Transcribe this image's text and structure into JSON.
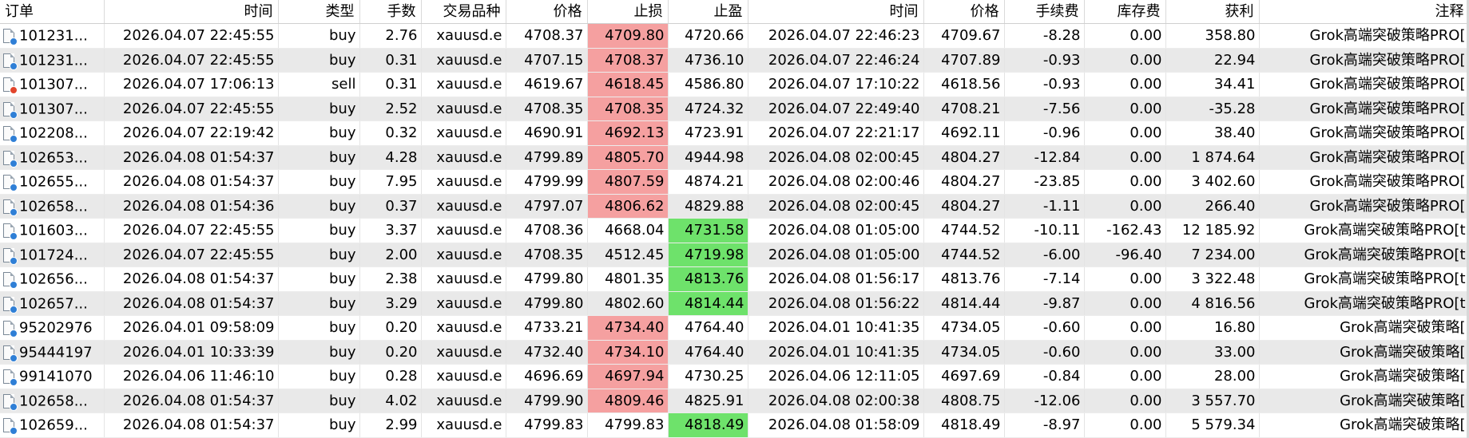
{
  "columns": [
    {
      "key": "order",
      "label": "订单"
    },
    {
      "key": "open_time",
      "label": "时间"
    },
    {
      "key": "type",
      "label": "类型"
    },
    {
      "key": "volume",
      "label": "手数"
    },
    {
      "key": "symbol",
      "label": "交易品种"
    },
    {
      "key": "open_price",
      "label": "价格"
    },
    {
      "key": "sl",
      "label": "止损"
    },
    {
      "key": "tp",
      "label": "止盈"
    },
    {
      "key": "close_time",
      "label": "时间"
    },
    {
      "key": "close_price",
      "label": "价格"
    },
    {
      "key": "commission",
      "label": "手续费"
    },
    {
      "key": "swap",
      "label": "库存费"
    },
    {
      "key": "profit",
      "label": "获利"
    },
    {
      "key": "comment",
      "label": "注释"
    }
  ],
  "colors": {
    "sl_highlight": "#f5a0a0",
    "tp_highlight": "#6ee26b",
    "alt_row": "#e9e9e9",
    "buy_dot": "#2f7fd6",
    "sell_dot": "#e2452c"
  },
  "rows": [
    {
      "icon": "buy-position-icon",
      "order": "101231...",
      "open_time": "2026.04.07 22:45:55",
      "type": "buy",
      "volume": "2.76",
      "symbol": "xauusd.e",
      "open_price": "4708.37",
      "sl": "4709.80",
      "tp": "4720.66",
      "close_time": "2026.04.07 22:46:23",
      "close_price": "4709.67",
      "commission": "-8.28",
      "swap": "0.00",
      "profit": "358.80",
      "comment": "Grok高端突破策略PRO[",
      "hit": "sl"
    },
    {
      "icon": "buy-position-icon",
      "order": "101231...",
      "open_time": "2026.04.07 22:45:55",
      "type": "buy",
      "volume": "0.31",
      "symbol": "xauusd.e",
      "open_price": "4707.15",
      "sl": "4708.37",
      "tp": "4736.10",
      "close_time": "2026.04.07 22:46:24",
      "close_price": "4707.89",
      "commission": "-0.93",
      "swap": "0.00",
      "profit": "22.94",
      "comment": "Grok高端突破策略PRO[",
      "hit": "sl"
    },
    {
      "icon": "sell-position-icon",
      "order": "101307...",
      "open_time": "2026.04.07 17:06:13",
      "type": "sell",
      "volume": "0.31",
      "symbol": "xauusd.e",
      "open_price": "4619.67",
      "sl": "4618.45",
      "tp": "4586.80",
      "close_time": "2026.04.07 17:10:22",
      "close_price": "4618.56",
      "commission": "-0.93",
      "swap": "0.00",
      "profit": "34.41",
      "comment": "Grok高端突破策略PRO[",
      "hit": "sl"
    },
    {
      "icon": "buy-position-icon",
      "order": "101307...",
      "open_time": "2026.04.07 22:45:55",
      "type": "buy",
      "volume": "2.52",
      "symbol": "xauusd.e",
      "open_price": "4708.35",
      "sl": "4708.35",
      "tp": "4724.32",
      "close_time": "2026.04.07 22:49:40",
      "close_price": "4708.21",
      "commission": "-7.56",
      "swap": "0.00",
      "profit": "-35.28",
      "comment": "Grok高端突破策略PRO[",
      "hit": "sl"
    },
    {
      "icon": "buy-position-icon",
      "order": "102208...",
      "open_time": "2026.04.07 22:19:42",
      "type": "buy",
      "volume": "0.32",
      "symbol": "xauusd.e",
      "open_price": "4690.91",
      "sl": "4692.13",
      "tp": "4723.91",
      "close_time": "2026.04.07 22:21:17",
      "close_price": "4692.11",
      "commission": "-0.96",
      "swap": "0.00",
      "profit": "38.40",
      "comment": "Grok高端突破策略PRO[",
      "hit": "sl"
    },
    {
      "icon": "buy-position-icon",
      "order": "102653...",
      "open_time": "2026.04.08 01:54:37",
      "type": "buy",
      "volume": "4.28",
      "symbol": "xauusd.e",
      "open_price": "4799.89",
      "sl": "4805.70",
      "tp": "4944.98",
      "close_time": "2026.04.08 02:00:45",
      "close_price": "4804.27",
      "commission": "-12.84",
      "swap": "0.00",
      "profit": "1 874.64",
      "comment": "Grok高端突破策略PRO[",
      "hit": "sl"
    },
    {
      "icon": "buy-position-icon",
      "order": "102655...",
      "open_time": "2026.04.08 01:54:37",
      "type": "buy",
      "volume": "7.95",
      "symbol": "xauusd.e",
      "open_price": "4799.99",
      "sl": "4807.59",
      "tp": "4874.21",
      "close_time": "2026.04.08 02:00:46",
      "close_price": "4804.27",
      "commission": "-23.85",
      "swap": "0.00",
      "profit": "3 402.60",
      "comment": "Grok高端突破策略PRO[",
      "hit": "sl"
    },
    {
      "icon": "buy-position-icon",
      "order": "102658...",
      "open_time": "2026.04.08 01:54:36",
      "type": "buy",
      "volume": "0.37",
      "symbol": "xauusd.e",
      "open_price": "4797.07",
      "sl": "4806.62",
      "tp": "4829.88",
      "close_time": "2026.04.08 02:00:45",
      "close_price": "4804.27",
      "commission": "-1.11",
      "swap": "0.00",
      "profit": "266.40",
      "comment": "Grok高端突破策略PRO[",
      "hit": "sl"
    },
    {
      "icon": "buy-position-icon",
      "order": "101603...",
      "open_time": "2026.04.07 22:45:55",
      "type": "buy",
      "volume": "3.37",
      "symbol": "xauusd.e",
      "open_price": "4708.36",
      "sl": "4668.04",
      "tp": "4731.58",
      "close_time": "2026.04.08 01:05:00",
      "close_price": "4744.52",
      "commission": "-10.11",
      "swap": "-162.43",
      "profit": "12 185.92",
      "comment": "Grok高端突破策略PRO[t",
      "hit": "tp"
    },
    {
      "icon": "buy-position-icon",
      "order": "101724...",
      "open_time": "2026.04.07 22:45:55",
      "type": "buy",
      "volume": "2.00",
      "symbol": "xauusd.e",
      "open_price": "4708.35",
      "sl": "4512.45",
      "tp": "4719.98",
      "close_time": "2026.04.08 01:05:00",
      "close_price": "4744.52",
      "commission": "-6.00",
      "swap": "-96.40",
      "profit": "7 234.00",
      "comment": "Grok高端突破策略PRO[t",
      "hit": "tp"
    },
    {
      "icon": "buy-position-icon",
      "order": "102656...",
      "open_time": "2026.04.08 01:54:37",
      "type": "buy",
      "volume": "2.38",
      "symbol": "xauusd.e",
      "open_price": "4799.80",
      "sl": "4801.35",
      "tp": "4813.76",
      "close_time": "2026.04.08 01:56:17",
      "close_price": "4813.76",
      "commission": "-7.14",
      "swap": "0.00",
      "profit": "3 322.48",
      "comment": "Grok高端突破策略PRO[t",
      "hit": "tp"
    },
    {
      "icon": "buy-position-icon",
      "order": "102657...",
      "open_time": "2026.04.08 01:54:37",
      "type": "buy",
      "volume": "3.29",
      "symbol": "xauusd.e",
      "open_price": "4799.80",
      "sl": "4802.60",
      "tp": "4814.44",
      "close_time": "2026.04.08 01:56:22",
      "close_price": "4814.44",
      "commission": "-9.87",
      "swap": "0.00",
      "profit": "4 816.56",
      "comment": "Grok高端突破策略PRO[t",
      "hit": "tp"
    },
    {
      "icon": "buy-position-icon",
      "order": "95202976",
      "open_time": "2026.04.01 09:58:09",
      "type": "buy",
      "volume": "0.20",
      "symbol": "xauusd.e",
      "open_price": "4733.21",
      "sl": "4734.40",
      "tp": "4764.40",
      "close_time": "2026.04.01 10:41:35",
      "close_price": "4734.05",
      "commission": "-0.60",
      "swap": "0.00",
      "profit": "16.80",
      "comment": "Grok高端突破策略[",
      "hit": "sl"
    },
    {
      "icon": "buy-position-icon",
      "order": "95444197",
      "open_time": "2026.04.01 10:33:39",
      "type": "buy",
      "volume": "0.20",
      "symbol": "xauusd.e",
      "open_price": "4732.40",
      "sl": "4734.10",
      "tp": "4764.40",
      "close_time": "2026.04.01 10:41:35",
      "close_price": "4734.05",
      "commission": "-0.60",
      "swap": "0.00",
      "profit": "33.00",
      "comment": "Grok高端突破策略[",
      "hit": "sl"
    },
    {
      "icon": "buy-position-icon",
      "order": "99141070",
      "open_time": "2026.04.06 11:46:10",
      "type": "buy",
      "volume": "0.28",
      "symbol": "xauusd.e",
      "open_price": "4696.69",
      "sl": "4697.94",
      "tp": "4730.25",
      "close_time": "2026.04.06 12:11:05",
      "close_price": "4697.69",
      "commission": "-0.84",
      "swap": "0.00",
      "profit": "28.00",
      "comment": "Grok高端突破策略[",
      "hit": "sl"
    },
    {
      "icon": "buy-position-icon",
      "order": "102658...",
      "open_time": "2026.04.08 01:54:37",
      "type": "buy",
      "volume": "4.02",
      "symbol": "xauusd.e",
      "open_price": "4799.90",
      "sl": "4809.46",
      "tp": "4825.91",
      "close_time": "2026.04.08 02:00:38",
      "close_price": "4808.75",
      "commission": "-12.06",
      "swap": "0.00",
      "profit": "3 557.70",
      "comment": "Grok高端突破策略[",
      "hit": "sl"
    },
    {
      "icon": "buy-position-icon",
      "order": "102659...",
      "open_time": "2026.04.08 01:54:37",
      "type": "buy",
      "volume": "2.99",
      "symbol": "xauusd.e",
      "open_price": "4799.83",
      "sl": "4799.83",
      "tp": "4818.49",
      "close_time": "2026.04.08 01:58:09",
      "close_price": "4818.49",
      "commission": "-8.97",
      "swap": "0.00",
      "profit": "5 579.34",
      "comment": "Grok高端突破策略[",
      "hit": "tp"
    }
  ]
}
